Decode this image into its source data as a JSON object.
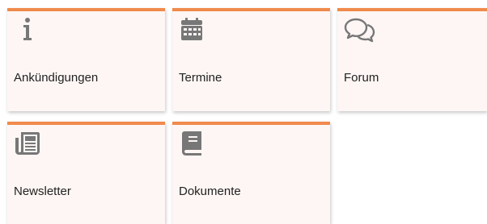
{
  "accent_color": "#f08a4b",
  "icon_color": "#777777",
  "tiles": [
    {
      "label": "Ankündigungen",
      "icon": "info-icon"
    },
    {
      "label": "Termine",
      "icon": "calendar-icon"
    },
    {
      "label": "Forum",
      "icon": "chat-bubbles-icon"
    },
    {
      "label": "Newsletter",
      "icon": "newspaper-icon"
    },
    {
      "label": "Dokumente",
      "icon": "book-icon"
    }
  ]
}
